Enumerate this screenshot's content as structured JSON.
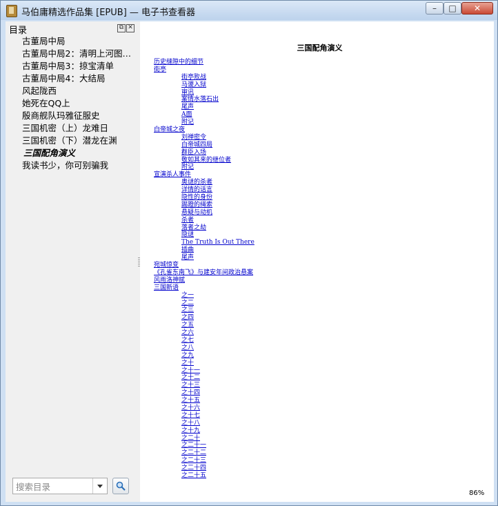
{
  "window": {
    "title": "马伯庸精选作品集 [EPUB] — 电子书查看器",
    "controls": {
      "minimize": "–",
      "maximize": "□",
      "close": "✕"
    }
  },
  "sidebar": {
    "title": "目录",
    "items": [
      {
        "label": "古董局中局"
      },
      {
        "label": "古董局中局2：清明上河图…"
      },
      {
        "label": "古董局中局3：掠宝清单"
      },
      {
        "label": "古董局中局4：大结局"
      },
      {
        "label": "风起陇西"
      },
      {
        "label": "她死在QQ上"
      },
      {
        "label": "殷商舰队玛雅征服史"
      },
      {
        "label": "三国机密（上）龙难日"
      },
      {
        "label": "三国机密（下）潜龙在渊"
      },
      {
        "label": "三国配角演义",
        "active": true
      },
      {
        "label": "我读书少，你可别骗我"
      }
    ],
    "search_placeholder": "搜索目录",
    "search_value": ""
  },
  "content": {
    "book_title": "三国配角演义",
    "toc": [
      {
        "text": "历史缝隙中的细节",
        "level": 1
      },
      {
        "text": "街亭",
        "level": 1
      },
      {
        "text": "街亭败战",
        "level": 2
      },
      {
        "text": "马谡入狱",
        "level": 2
      },
      {
        "text": "审讯",
        "level": 2
      },
      {
        "text": "案情水落石出",
        "level": 2
      },
      {
        "text": "尾声",
        "level": 2
      },
      {
        "text": "A面",
        "level": 2
      },
      {
        "text": "附记",
        "level": 2
      },
      {
        "text": "白帝城之夜",
        "level": 1
      },
      {
        "text": "刘禅密令",
        "level": 2
      },
      {
        "text": "白帝城四局",
        "level": 2
      },
      {
        "text": "群臣入场",
        "level": 2
      },
      {
        "text": "敬如其来的继位者",
        "level": 2
      },
      {
        "text": "附记",
        "level": 2
      },
      {
        "text": "宣演杀人事件",
        "level": 1
      },
      {
        "text": "奥谜的杀者",
        "level": 2
      },
      {
        "text": "详情的话言",
        "level": 2
      },
      {
        "text": "隐性的身份",
        "level": 2
      },
      {
        "text": "踢蹬的绳索",
        "level": 2
      },
      {
        "text": "悬疑与动机",
        "level": 2
      },
      {
        "text": "杀者",
        "level": 2
      },
      {
        "text": "落者之劫",
        "level": 2
      },
      {
        "text": "隐谜",
        "level": 2
      },
      {
        "text": "The Truth Is Out There",
        "level": 2
      },
      {
        "text": "插曲",
        "level": 2
      },
      {
        "text": "尾声",
        "level": 2
      },
      {
        "text": "宛城惊变",
        "level": 1
      },
      {
        "text": "《孔雀东南飞》与建安年间政治悬案",
        "level": 1
      },
      {
        "text": "风雨洛神赋",
        "level": 1
      },
      {
        "text": "三国新语",
        "level": 1
      },
      {
        "text": "之一",
        "level": 2
      },
      {
        "text": "之二",
        "level": 2
      },
      {
        "text": "之三",
        "level": 2
      },
      {
        "text": "之四",
        "level": 2
      },
      {
        "text": "之五",
        "level": 2
      },
      {
        "text": "之六",
        "level": 2
      },
      {
        "text": "之七",
        "level": 2
      },
      {
        "text": "之八",
        "level": 2
      },
      {
        "text": "之九",
        "level": 2
      },
      {
        "text": "之十",
        "level": 2
      },
      {
        "text": "之十一",
        "level": 2
      },
      {
        "text": "之十二",
        "level": 2
      },
      {
        "text": "之十三",
        "level": 2
      },
      {
        "text": "之十四",
        "level": 2
      },
      {
        "text": "之十五",
        "level": 2
      },
      {
        "text": "之十六",
        "level": 2
      },
      {
        "text": "之十七",
        "level": 2
      },
      {
        "text": "之十八",
        "level": 2
      },
      {
        "text": "之十九",
        "level": 2
      },
      {
        "text": "之二十",
        "level": 2
      },
      {
        "text": "之二十一",
        "level": 2
      },
      {
        "text": "之二十二",
        "level": 2
      },
      {
        "text": "之二十三",
        "level": 2
      },
      {
        "text": "之二十四",
        "level": 2
      },
      {
        "text": "之二十五",
        "level": 2
      }
    ]
  },
  "status": {
    "zoom": "86%"
  }
}
